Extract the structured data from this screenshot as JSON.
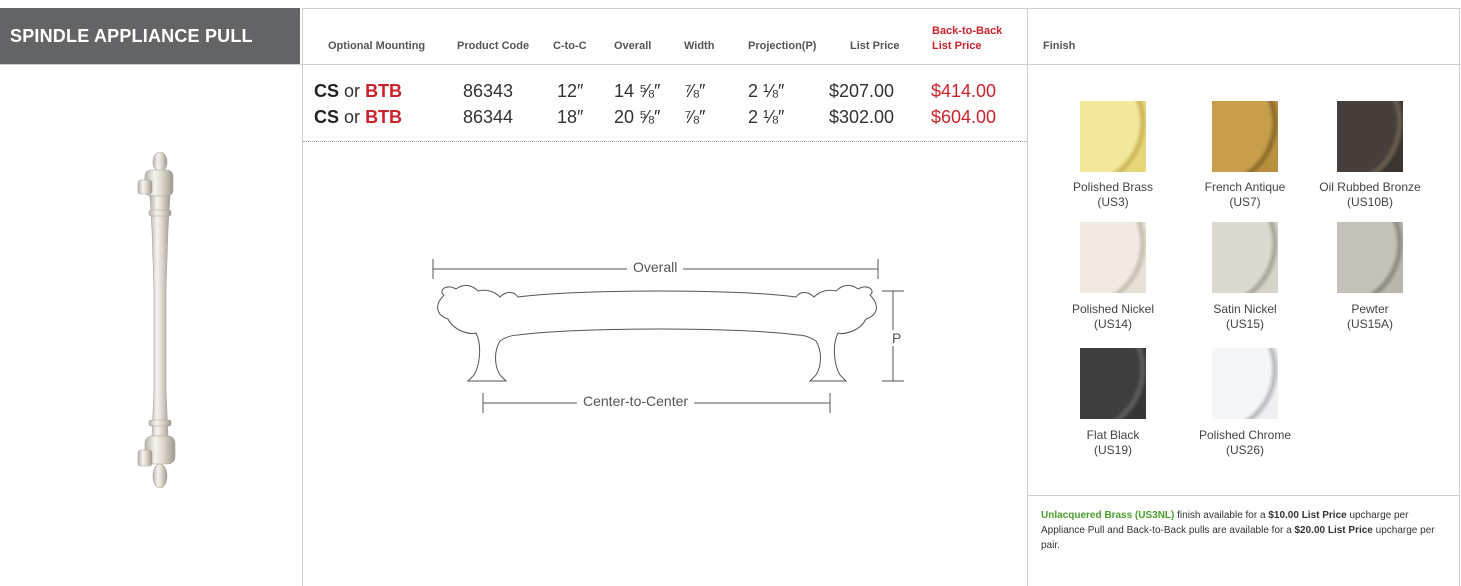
{
  "title": "SPINDLE APPLIANCE PULL",
  "headers": {
    "mounting": "Optional Mounting",
    "code": "Product Code",
    "ctc": "C-to-C",
    "overall": "Overall",
    "width": "Width",
    "projection": "Projection(P)",
    "list_price": "List Price",
    "btb_line1": "Back-to-Back",
    "btb_line2": "List Price",
    "finish": "Finish"
  },
  "rows": [
    {
      "cs": "CS",
      "or": "or",
      "btb": "BTB",
      "code": "86343",
      "ctc": "12″",
      "overall": "14 ⅝″",
      "width": "⅞″",
      "projection": "2 ⅛″",
      "price": "$207.00",
      "btb_price": "$414.00"
    },
    {
      "cs": "CS",
      "or": "or",
      "btb": "BTB",
      "code": "86344",
      "ctc": "18″",
      "overall": "20 ⅝″",
      "width": "⅞″",
      "projection": "2 ⅛″",
      "price": "$302.00",
      "btb_price": "$604.00"
    }
  ],
  "diagram": {
    "overall": "Overall",
    "ctc": "Center-to-Center",
    "p": "P"
  },
  "finishes": [
    {
      "name": "Polished Brass",
      "code": "(US3)",
      "color": "#e8d779"
    },
    {
      "name": "French Antique",
      "code": "(US7)",
      "color": "#b8903e"
    },
    {
      "name": "Oil Rubbed Bronze",
      "code": "(US10B)",
      "color": "#3f3a36"
    },
    {
      "name": "Polished Nickel",
      "code": "(US14)",
      "color": "#e7e2d7"
    },
    {
      "name": "Satin Nickel",
      "code": "(US15)",
      "color": "#d6d3cb"
    },
    {
      "name": "Pewter",
      "code": "(US15A)",
      "color": "#b9b6ac"
    },
    {
      "name": "Flat Black",
      "code": "(US19)",
      "color": "#3a3939"
    },
    {
      "name": "Polished Chrome",
      "code": "(US26)",
      "color": "#eef0f2"
    }
  ],
  "note": {
    "green": "Unlacquered Brass (US3NL)",
    "t1": " finish available for a ",
    "b1": "$10.00 List Price",
    "t2": " upcharge per Appliance Pull and Back-to-Back pulls are available for a ",
    "b2": "$20.00 List Price",
    "t3": " upcharge per pair."
  },
  "colors": {
    "title_bg": "#636466",
    "accent_red": "#cc2229",
    "accent_green": "#4aa02c"
  }
}
